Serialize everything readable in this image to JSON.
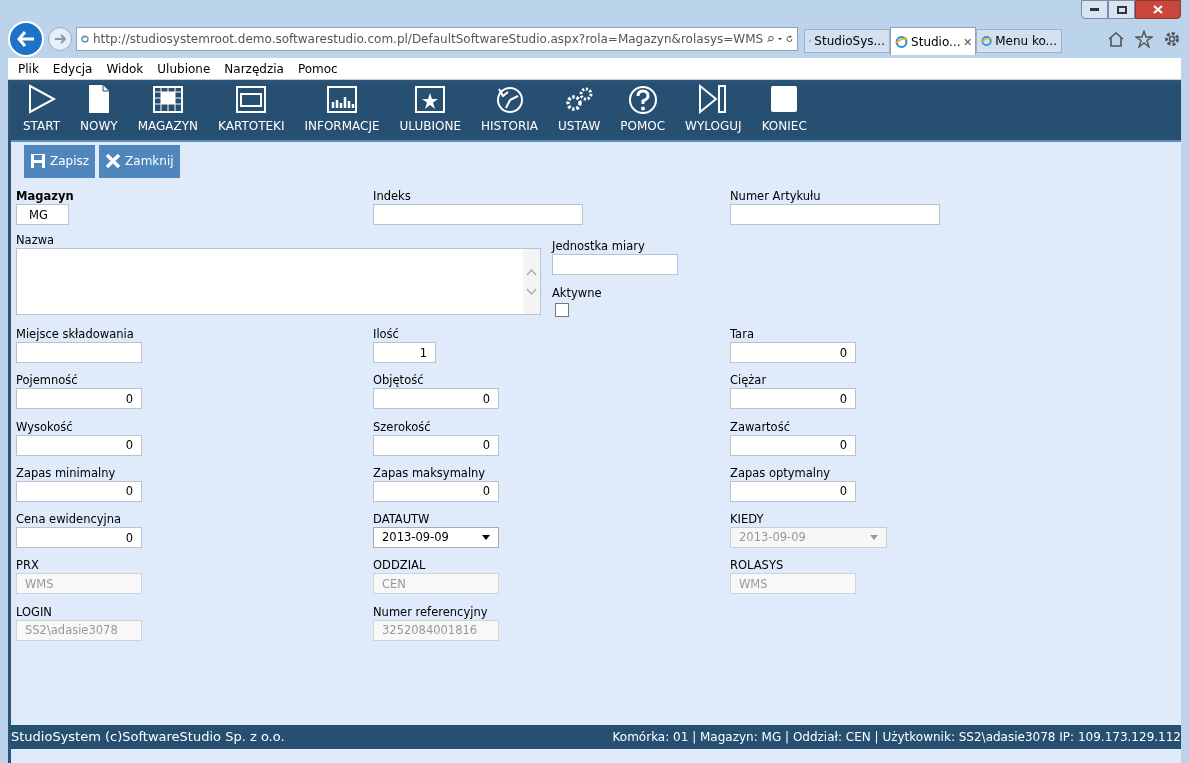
{
  "browser": {
    "address": "http://studiosystemroot.demo.softwarestudio.com.pl/DefaultSoftwareStudio.aspx?rola=Magazyn&rolasys=WMS",
    "tabs": [
      {
        "label": "StudioSys...",
        "selected": false
      },
      {
        "label": "Studio...",
        "selected": true
      },
      {
        "label": "Menu ko...",
        "selected": false
      }
    ],
    "menu": [
      "Plik",
      "Edycja",
      "Widok",
      "Ulubione",
      "Narzędzia",
      "Pomoc"
    ]
  },
  "toolbar": [
    {
      "label": "START",
      "kind": "start"
    },
    {
      "label": "NOWY",
      "kind": "new"
    },
    {
      "label": "MAGAZYN",
      "kind": "grid"
    },
    {
      "label": "KARTOTEKI",
      "kind": "window"
    },
    {
      "label": "INFORMACJE",
      "kind": "chart"
    },
    {
      "label": "ULUBIONE",
      "kind": "star"
    },
    {
      "label": "HISTORIA",
      "kind": "history"
    },
    {
      "label": "USTAW",
      "kind": "gears"
    },
    {
      "label": "POMOC",
      "kind": "help"
    },
    {
      "label": "WYLOGUJ",
      "kind": "logout"
    },
    {
      "label": "KONIEC",
      "kind": "end"
    }
  ],
  "actions": [
    {
      "label": "Zapisz",
      "kind": "save"
    },
    {
      "label": "Zamknij",
      "kind": "close"
    }
  ],
  "form": {
    "magazyn": {
      "label": "Magazyn",
      "value": "MG"
    },
    "indeks": {
      "label": "Indeks"
    },
    "numer_artykulu": {
      "label": "Numer Artykułu"
    },
    "nazwa": {
      "label": "Nazwa"
    },
    "jednostka": {
      "label": "Jednostka miary"
    },
    "aktywne": {
      "label": "Aktywne",
      "checked": false
    },
    "rows": [
      [
        {
          "label": "Miejsce składowania",
          "kind": "text",
          "disabled": false
        },
        {
          "label": "Ilość",
          "value": "1",
          "kind": "short",
          "disabled": false
        },
        {
          "label": "Tara",
          "value": "0",
          "kind": "number",
          "disabled": false
        }
      ],
      [
        {
          "label": "Pojemność",
          "value": "0",
          "kind": "number",
          "disabled": false
        },
        {
          "label": "Objętość",
          "value": "0",
          "kind": "number",
          "disabled": false
        },
        {
          "label": "Ciężar",
          "value": "0",
          "kind": "number",
          "disabled": false
        }
      ],
      [
        {
          "label": "Wysokość",
          "value": "0",
          "kind": "number",
          "disabled": false
        },
        {
          "label": "Szerokość",
          "value": "0",
          "kind": "number",
          "disabled": false
        },
        {
          "label": "Zawartość",
          "value": "0",
          "kind": "number",
          "disabled": false
        }
      ],
      [
        {
          "label": "Zapas minimalny",
          "value": "0",
          "kind": "number",
          "disabled": false
        },
        {
          "label": "Zapas maksymalny",
          "value": "0",
          "kind": "number",
          "disabled": false
        },
        {
          "label": "Zapas optymalny",
          "value": "0",
          "kind": "number",
          "disabled": false
        }
      ],
      [
        {
          "label": "Cena ewidencyjna",
          "value": "0",
          "kind": "number",
          "disabled": false
        },
        {
          "label": "DATAUTW",
          "value": "2013-09-09",
          "kind": "select",
          "disabled": false
        },
        {
          "label": "KIEDY",
          "value": "2013-09-09",
          "kind": "select",
          "disabled": true
        }
      ],
      [
        {
          "label": "PRX",
          "value": "WMS",
          "kind": "text",
          "disabled": true
        },
        {
          "label": "ODDZIAL",
          "value": "CEN",
          "kind": "text",
          "disabled": true
        },
        {
          "label": "ROLASYS",
          "value": "WMS",
          "kind": "text",
          "disabled": true
        }
      ],
      [
        {
          "label": "LOGIN",
          "value": "SS2\\adasie3078",
          "kind": "text",
          "disabled": true
        },
        {
          "label": "Numer referencyjny",
          "value": "3252084001816",
          "kind": "text",
          "disabled": true
        },
        null
      ]
    ]
  },
  "footer": {
    "left": "StudioSystem (c)SoftwareStudio Sp. z o.o.",
    "right": "Komórka: 01 | Magazyn: MG | Oddział: CEN | Użytkownik: SS2\\adasie3078 IP: 109.173.129.112"
  }
}
